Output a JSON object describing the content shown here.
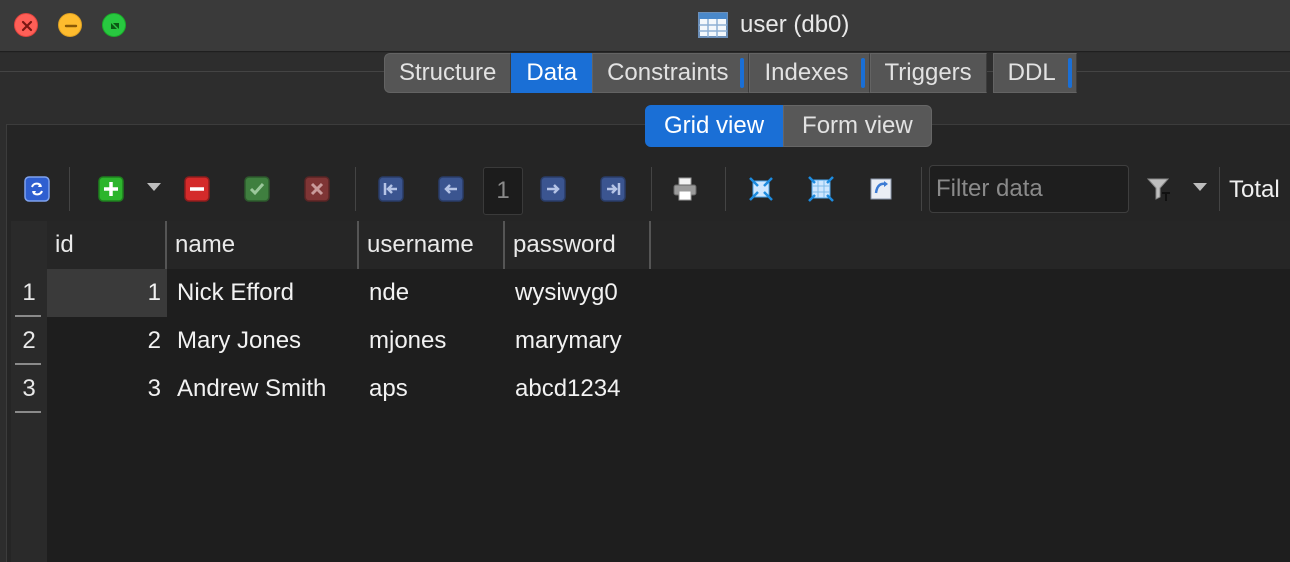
{
  "window": {
    "title": "user (db0)",
    "title_icon": "table-icon"
  },
  "tabs": [
    {
      "label": "Structure",
      "active": false
    },
    {
      "label": "Data",
      "active": true
    },
    {
      "label": "Constraints",
      "active": false
    },
    {
      "label": "Indexes",
      "active": false
    },
    {
      "label": "Triggers",
      "active": false
    },
    {
      "label": "DDL",
      "active": false
    }
  ],
  "views": [
    {
      "label": "Grid view",
      "active": true
    },
    {
      "label": "Form view",
      "active": false
    }
  ],
  "toolbar": {
    "page_number": "1",
    "filter_placeholder": "Filter data",
    "total_label": "Total",
    "icons": [
      "refresh-icon",
      "insert-row-icon",
      "delete-row-icon",
      "commit-icon",
      "rollback-icon",
      "first-page-icon",
      "previous-page-icon",
      "next-page-icon",
      "last-page-icon",
      "print-icon",
      "fit-columns-icon",
      "fit-columns-all-icon",
      "export-icon",
      "filter-icon"
    ]
  },
  "grid": {
    "columns": [
      "id",
      "name",
      "username",
      "password"
    ],
    "rows": [
      {
        "num": "1",
        "id": "1",
        "name": "Nick Efford",
        "username": "nde",
        "password": "wysiwyg0"
      },
      {
        "num": "2",
        "id": "2",
        "name": "Mary Jones",
        "username": "mjones",
        "password": "marymary"
      },
      {
        "num": "3",
        "id": "3",
        "name": "Andrew Smith",
        "username": "aps",
        "password": "abcd1234"
      }
    ]
  },
  "colors": {
    "accent": "#1a6fd6",
    "close": "#ff5f57",
    "minimize": "#febc2e",
    "zoom": "#28c840"
  }
}
